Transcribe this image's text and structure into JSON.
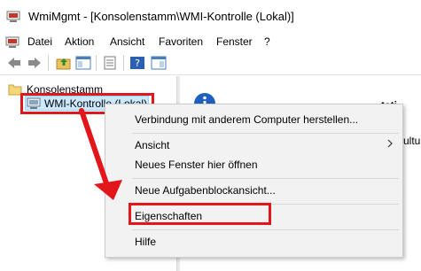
{
  "window": {
    "title": "WmiMgmt - [Konsolenstamm\\WMI-Kontrolle (Lokal)]"
  },
  "menubar": {
    "items": [
      "Datei",
      "Aktion",
      "Ansicht",
      "Favoriten",
      "Fenster",
      "?"
    ]
  },
  "toolbar": {
    "icons": [
      "back-arrow-icon",
      "forward-arrow-icon",
      "folder-up-icon",
      "show-hide-tree-icon",
      "properties-icon",
      "help-icon",
      "show-hide-action-pane-icon"
    ]
  },
  "tree": {
    "root": "Konsolenstamm",
    "child": "WMI-Kontrolle (Lokal)"
  },
  "right_pane": {
    "heading_partial": "Wi... V... lt ... i... t... ... tati",
    "side_text_partial": "ultu"
  },
  "context_menu": {
    "items": [
      {
        "label": "Verbindung mit anderem Computer herstellen..."
      },
      {
        "label": "Ansicht",
        "submenu": true
      },
      {
        "label": "Neues Fenster hier öffnen"
      },
      {
        "label": "Neue Aufgabenblockansicht..."
      },
      {
        "label": "Eigenschaften"
      },
      {
        "label": "Hilfe"
      }
    ]
  },
  "colors": {
    "highlight": "#e2171c",
    "selection": "#cce8ff",
    "menu_bg": "#f2f2f2"
  }
}
